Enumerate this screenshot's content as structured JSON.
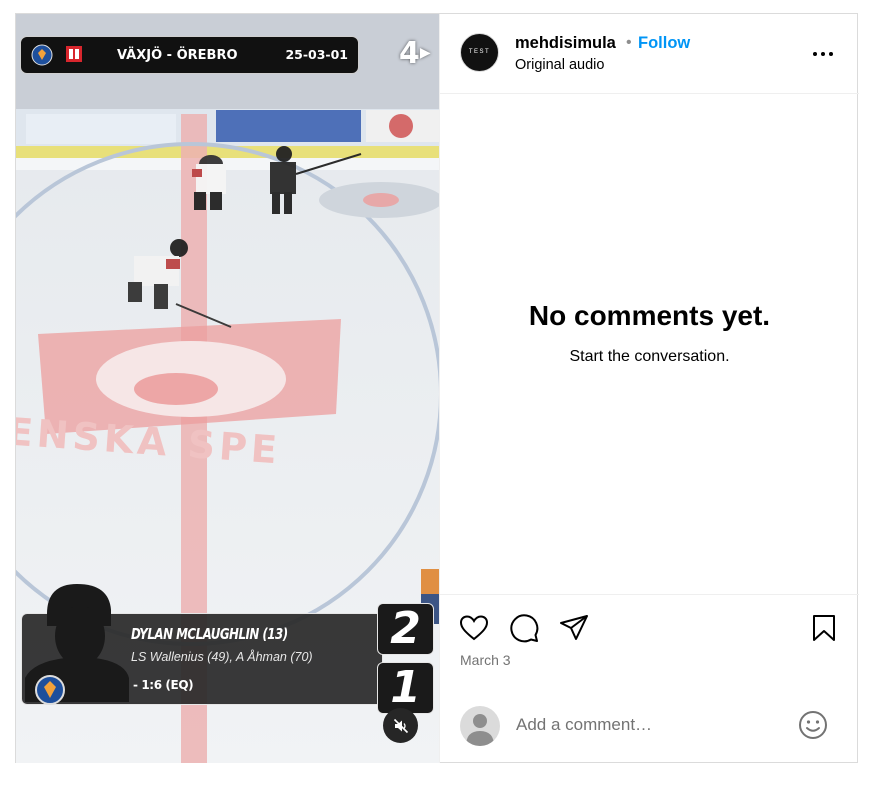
{
  "video": {
    "scorebug": {
      "teams": "VÄXJÖ - ÖREBRO",
      "date": "25-03-01"
    },
    "channel_logo": "4",
    "goal_card": {
      "player": "DYLAN MCLAUGHLIN (13)",
      "assists": "LS Wallenius (49), A Åhman (70)",
      "time": "- 1:6 (EQ)",
      "home_score": "2",
      "away_score": "1"
    },
    "mute_icon": "speaker-muted-icon",
    "rink_ad_text": "ENSKA SPE"
  },
  "header": {
    "avatar_text": "TEST",
    "username": "mehdisimula",
    "separator": "•",
    "follow_label": "Follow",
    "audio_label": "Original audio",
    "more_icon": "more-horizontal-icon"
  },
  "comments": {
    "empty_title": "No comments yet.",
    "empty_subtitle": "Start the conversation."
  },
  "actions": {
    "icons": [
      "heart-icon",
      "comment-icon",
      "share-icon",
      "bookmark-icon"
    ],
    "date": "March 3"
  },
  "comment_box": {
    "placeholder": "Add a comment…",
    "emoji_icon": "emoji-icon"
  },
  "colors": {
    "accent": "#0095f6",
    "border": "#dbdbdb",
    "muted": "#737373"
  }
}
